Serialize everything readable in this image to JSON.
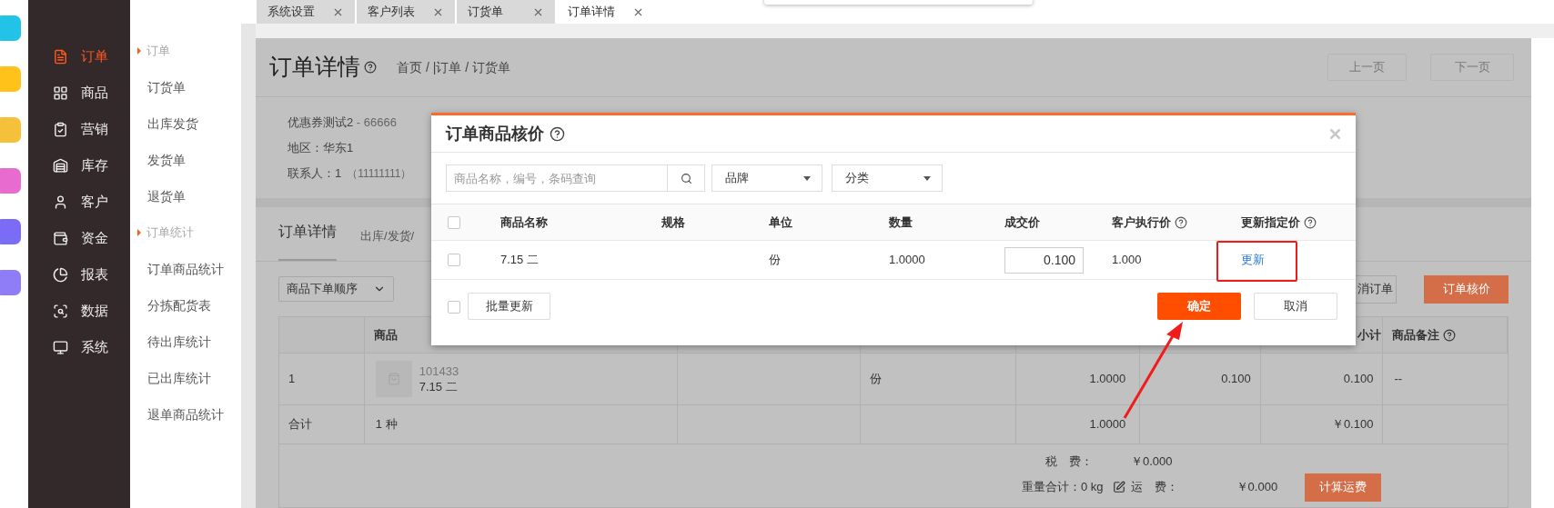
{
  "nav": [
    {
      "label": "订单",
      "selected": true
    },
    {
      "label": "商品",
      "selected": false
    },
    {
      "label": "营销",
      "selected": false
    },
    {
      "label": "库存",
      "selected": false
    },
    {
      "label": "客户",
      "selected": false
    },
    {
      "label": "资金",
      "selected": false
    },
    {
      "label": "报表",
      "selected": false
    },
    {
      "label": "数据",
      "selected": false
    },
    {
      "label": "系统",
      "selected": false
    }
  ],
  "submenu": [
    {
      "kind": "group",
      "label": "订单"
    },
    {
      "kind": "item",
      "label": "订货单"
    },
    {
      "kind": "item",
      "label": "出库发货"
    },
    {
      "kind": "item",
      "label": "发货单"
    },
    {
      "kind": "item",
      "label": "退货单"
    },
    {
      "kind": "group",
      "label": "订单统计"
    },
    {
      "kind": "item",
      "label": "订单商品统计"
    },
    {
      "kind": "item",
      "label": "分拣配货表"
    },
    {
      "kind": "item",
      "label": "待出库统计"
    },
    {
      "kind": "item",
      "label": "已出库统计"
    },
    {
      "kind": "item",
      "label": "退单商品统计"
    }
  ],
  "tabs": [
    {
      "label": "系统设置",
      "selected": false
    },
    {
      "label": "客户列表",
      "selected": false
    },
    {
      "label": "订货单",
      "selected": false
    },
    {
      "label": "订单详情",
      "selected": true
    }
  ],
  "page": {
    "title": "订单详情",
    "breadcrumb": "首页 / |订单 / 订货单",
    "prev_button": "上一页",
    "next_button": "下一页"
  },
  "customer": {
    "name": "优惠券测试2",
    "code": " - 66666",
    "region": "地区：华东1",
    "contact": "联系人：1",
    "phone": "（11111111）"
  },
  "detail_tabs": [
    {
      "label": "订单详情",
      "selected": true
    },
    {
      "label": "出库/发货/",
      "selected": false
    }
  ],
  "sort_select": "商品下单顺序",
  "action_buttons": [
    {
      "kind": "outline",
      "label": "消订单"
    },
    {
      "kind": "primary",
      "label": "订单核价"
    }
  ],
  "table": {
    "column_2": "商品",
    "column_7": "小计",
    "column_8": "商品备注",
    "rows": [
      {
        "index": "1",
        "code": "101433",
        "name": "7.15 二",
        "unit": "份",
        "quantity": "1.0000",
        "price": "0.100",
        "subtotal": "0.100",
        "note": "--"
      }
    ],
    "totals": {
      "label": "合计",
      "kinds": "1 种",
      "quantity": "1.0000",
      "subtotal": "￥0.100"
    }
  },
  "fees": {
    "tax_label": "税　费：",
    "tax": "￥0.000",
    "weight": "重量合计：0 kg",
    "freight_label": "运　费：",
    "freight": "￥0.000",
    "button": "计算运费"
  },
  "modal": {
    "title": "订单商品核价",
    "search_placeholder": "商品名称，编号，条码查询",
    "brand": "品牌",
    "category": "分类",
    "header_checked": false,
    "columns": [
      {
        "label": "商品名称",
        "help": false
      },
      {
        "label": "规格",
        "help": false
      },
      {
        "label": "单位",
        "help": false
      },
      {
        "label": "数量",
        "help": false
      },
      {
        "label": "成交价",
        "help": false
      },
      {
        "label": "客户执行价",
        "help": true
      },
      {
        "label": "更新指定价",
        "help": true
      }
    ],
    "rows": [
      {
        "checked": false,
        "name": "7.15 二",
        "unit": "份",
        "quantity": "1.0000",
        "price": "0.100",
        "customer_price": "1.000",
        "action": "更新",
        "highlighted": true
      }
    ],
    "footer_checked": false,
    "batch_button": "批量更新",
    "confirm_button": "确定",
    "cancel_button": "取消"
  }
}
